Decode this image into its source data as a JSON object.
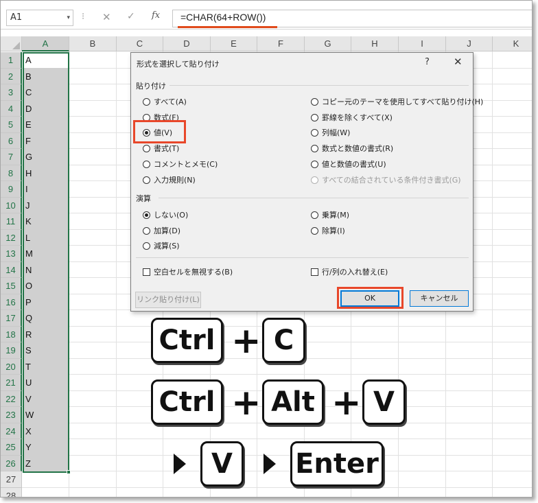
{
  "formula_bar": {
    "name_box": "A1",
    "name_box_caret": "▾",
    "separator": "⁝",
    "cancel_icon": "✕",
    "enter_icon": "✓",
    "fx_label": "fx",
    "formula": "=CHAR(64+ROW())"
  },
  "columns": [
    "A",
    "B",
    "C",
    "D",
    "E",
    "F",
    "G",
    "H",
    "I",
    "J",
    "K"
  ],
  "rows": [
    "1",
    "2",
    "3",
    "4",
    "5",
    "6",
    "7",
    "8",
    "9",
    "10",
    "11",
    "12",
    "13",
    "14",
    "15",
    "16",
    "17",
    "18",
    "19",
    "20",
    "21",
    "22",
    "23",
    "24",
    "25",
    "26",
    "27",
    "28"
  ],
  "column_a_values": [
    "A",
    "B",
    "C",
    "D",
    "E",
    "F",
    "G",
    "H",
    "I",
    "J",
    "K",
    "L",
    "M",
    "N",
    "O",
    "P",
    "Q",
    "R",
    "S",
    "T",
    "U",
    "V",
    "W",
    "X",
    "Y",
    "Z"
  ],
  "dialog": {
    "title": "形式を選択して貼り付け",
    "help": "?",
    "close": "✕",
    "paste_group": "貼り付け",
    "paste_left": [
      "すべて(A)",
      "数式(F)",
      "値(V)",
      "書式(T)",
      "コメントとメモ(C)",
      "入力規則(N)"
    ],
    "paste_right": [
      "コピー元のテーマを使用してすべて貼り付け(H)",
      "罫線を除くすべて(X)",
      "列幅(W)",
      "数式と数値の書式(R)",
      "値と数値の書式(U)",
      "すべての結合されている条件付き書式(G)"
    ],
    "paste_selected": "値(V)",
    "operation_group": "演算",
    "operation_left": [
      "しない(O)",
      "加算(D)",
      "減算(S)"
    ],
    "operation_right": [
      "乗算(M)",
      "除算(I)"
    ],
    "operation_selected": "しない(O)",
    "skip_blanks": "空白セルを無視する(B)",
    "transpose": "行/列の入れ替え(E)",
    "paste_link_button": "リンク貼り付け(L)",
    "ok_button": "OK",
    "cancel_button": "キャンセル"
  },
  "shortcuts": {
    "row1": [
      "Ctrl",
      "C"
    ],
    "row2": [
      "Ctrl",
      "Alt",
      "V"
    ],
    "row3": [
      "V",
      "Enter"
    ],
    "plus": "+"
  },
  "colors": {
    "highlight": "#e8472a",
    "excel_green": "#217346",
    "selection_fill": "#d0d0d0",
    "dialog_bg": "#f0f0f0"
  }
}
